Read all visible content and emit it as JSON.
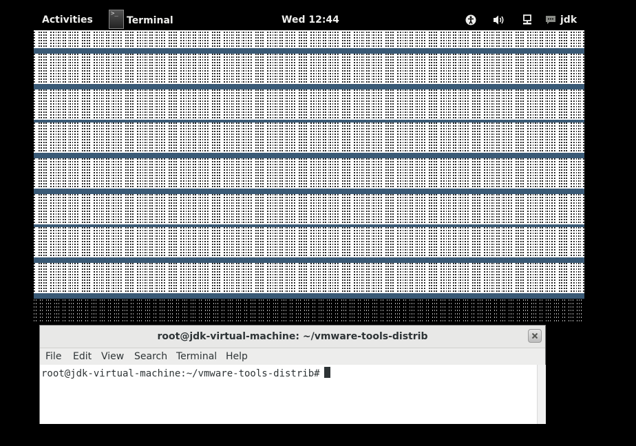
{
  "top_panel": {
    "activities_label": "Activities",
    "app_name": "Terminal",
    "app_icon": "terminal-icon",
    "clock": "Wed 12:44",
    "tray_icons": [
      "accessibility-icon",
      "volume-icon",
      "network-icon",
      "chat-icon"
    ],
    "user_name": "jdk"
  },
  "terminal": {
    "title": "root@jdk-virtual-machine: ~/vmware-tools-distrib",
    "menu": [
      "File",
      "Edit",
      "View",
      "Search",
      "Terminal",
      "Help"
    ],
    "prompt": "root@jdk-virtual-machine:~/vmware-tools-distrib#"
  },
  "colors": {
    "panel_bg": "#000000",
    "panel_text": "#eeeeec",
    "noise_separator": "#3a5a76",
    "window_titlebar": "#e8e8e7",
    "menu_bg": "#ededec"
  }
}
